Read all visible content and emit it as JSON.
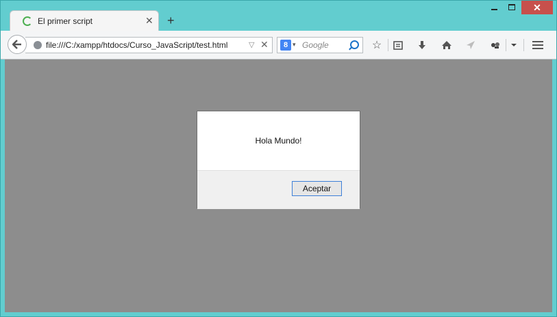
{
  "tab": {
    "title": "El primer script"
  },
  "address_bar": {
    "url": "file:///C:/xampp/htdocs/Curso_JavaScript/test.html"
  },
  "search_bar": {
    "placeholder": "Google",
    "engine_letter": "8"
  },
  "dialog": {
    "message": "Hola Mundo!",
    "ok_label": "Aceptar"
  },
  "colors": {
    "frame": "#62cdcf",
    "close_button": "#c7504c",
    "page_overlay": "#8d8d8d"
  }
}
